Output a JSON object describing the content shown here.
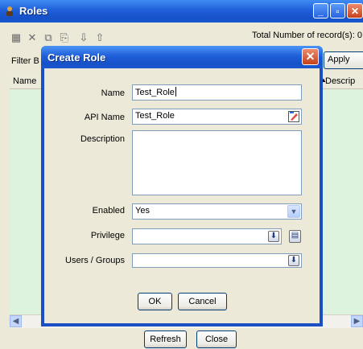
{
  "roles_window": {
    "title": "Roles",
    "total_records_label": "Total Number of record(s): 0",
    "filter_label": "Filter B",
    "apply_label": "Apply",
    "columns": [
      "Name",
      "Descrip"
    ],
    "refresh_label": "Refresh",
    "close_label": "Close"
  },
  "dialog": {
    "title": "Create Role",
    "fields": {
      "name_label": "Name",
      "name_value": "Test_Role",
      "api_name_label": "API Name",
      "api_name_value": "Test_Role",
      "description_label": "Description",
      "description_value": "",
      "enabled_label": "Enabled",
      "enabled_value": "Yes",
      "privilege_label": "Privilege",
      "privilege_value": "",
      "users_groups_label": "Users / Groups",
      "users_groups_value": ""
    },
    "ok_label": "OK",
    "cancel_label": "Cancel"
  },
  "icons": [
    "app-icon",
    "new-icon",
    "delete-icon",
    "copy-icon",
    "paste-icon",
    "export-icon",
    "import-icon",
    "edit-icon",
    "lookup-icon",
    "picker-icon",
    "dropdown-arrow-icon"
  ],
  "colors": {
    "titlebar": "#1f5fd9",
    "grid_background": "#ddf3dd",
    "dialog_frame": "#1d4fc4"
  }
}
